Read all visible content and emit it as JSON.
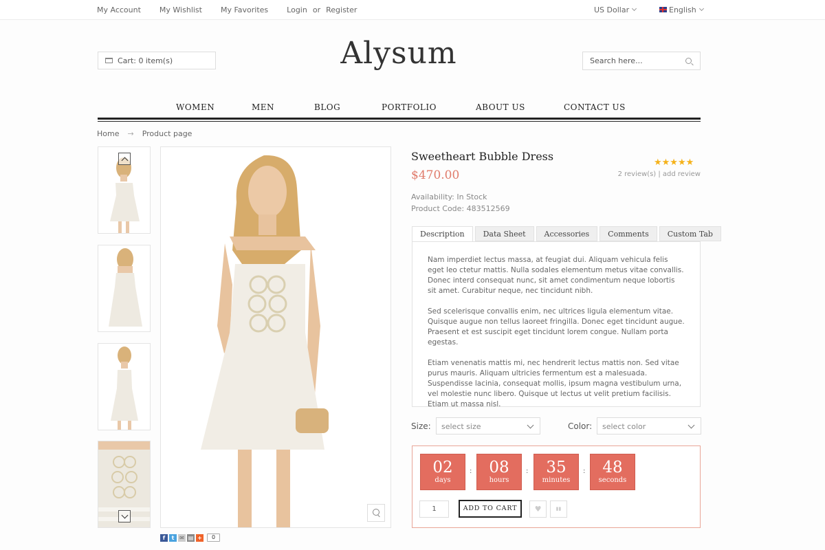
{
  "topbar": {
    "links": [
      "My Account",
      "My Wishlist",
      "My Favorites"
    ],
    "login": "Login",
    "or": "or",
    "register": "Register",
    "currency": "US Dollar",
    "language": "English"
  },
  "header": {
    "cart_label": "Cart: 0 item(s)",
    "logo": "Alysum",
    "search_placeholder": "Search here..."
  },
  "nav": [
    "WOMEN",
    "MEN",
    "BLOG",
    "PORTFOLIO",
    "ABOUT US",
    "CONTACT US"
  ],
  "breadcrumb": {
    "home": "Home",
    "arrow": "→",
    "current": "Product page"
  },
  "product": {
    "title": "Sweetheart Bubble Dress",
    "price": "$470.00",
    "rating_stars": "★★★★★",
    "rating": 5,
    "reviews": "2 review(s) | add review",
    "availability": "Availability: In Stock",
    "product_code": "Product Code: 483512569"
  },
  "tabs": [
    "Description",
    "Data Sheet",
    "Accessories",
    "Comments",
    "Custom Tab"
  ],
  "description": [
    "Nam imperdiet lectus massa, at feugiat dui. Aliquam vehicula felis eget leo ctetur mattis. Nulla sodales elementum metus vitae convallis. Donec interd consequat nunc, sit amet condimentum neque lobortis sit amet. Curabitur neque, nec tincidunt nibh.",
    "Sed scelerisque convallis enim, nec ultrices ligula elementum vitae. Quisque augue non tellus laoreet fringilla. Donec eget tincidunt augue. Praesent et est suscipit eget tincidunt lorem congue. Nullam porta egestas.",
    "Etiam venenatis mattis mi, nec hendrerit lectus mattis non. Sed vitae purus mauris. Aliquam ultricies fermentum est a malesuada. Suspendisse lacinia, consequat mollis, ipsum magna vestibulum urna, vel molestie nunc libero. Quisque ut lectus ut velit pretium facilisis. Etiam ut massa nisl."
  ],
  "options": {
    "size_label": "Size:",
    "size_value": "select size",
    "color_label": "Color:",
    "color_value": "select color"
  },
  "countdown": [
    {
      "value": "02",
      "unit": "days"
    },
    {
      "value": "08",
      "unit": "hours"
    },
    {
      "value": "35",
      "unit": "minutes"
    },
    {
      "value": "48",
      "unit": "seconds"
    }
  ],
  "countdown_separator": ":",
  "purchase": {
    "quantity": "1",
    "add_to_cart": "ADD TO CART",
    "wishlist_icon": "♥",
    "compare_icon": "▮▮"
  },
  "share": {
    "count": "0"
  },
  "colors": {
    "accent": "#e36d5f",
    "price": "#e07b6b",
    "stars": "#f5b21b",
    "countdown_border": "#e9a597"
  }
}
